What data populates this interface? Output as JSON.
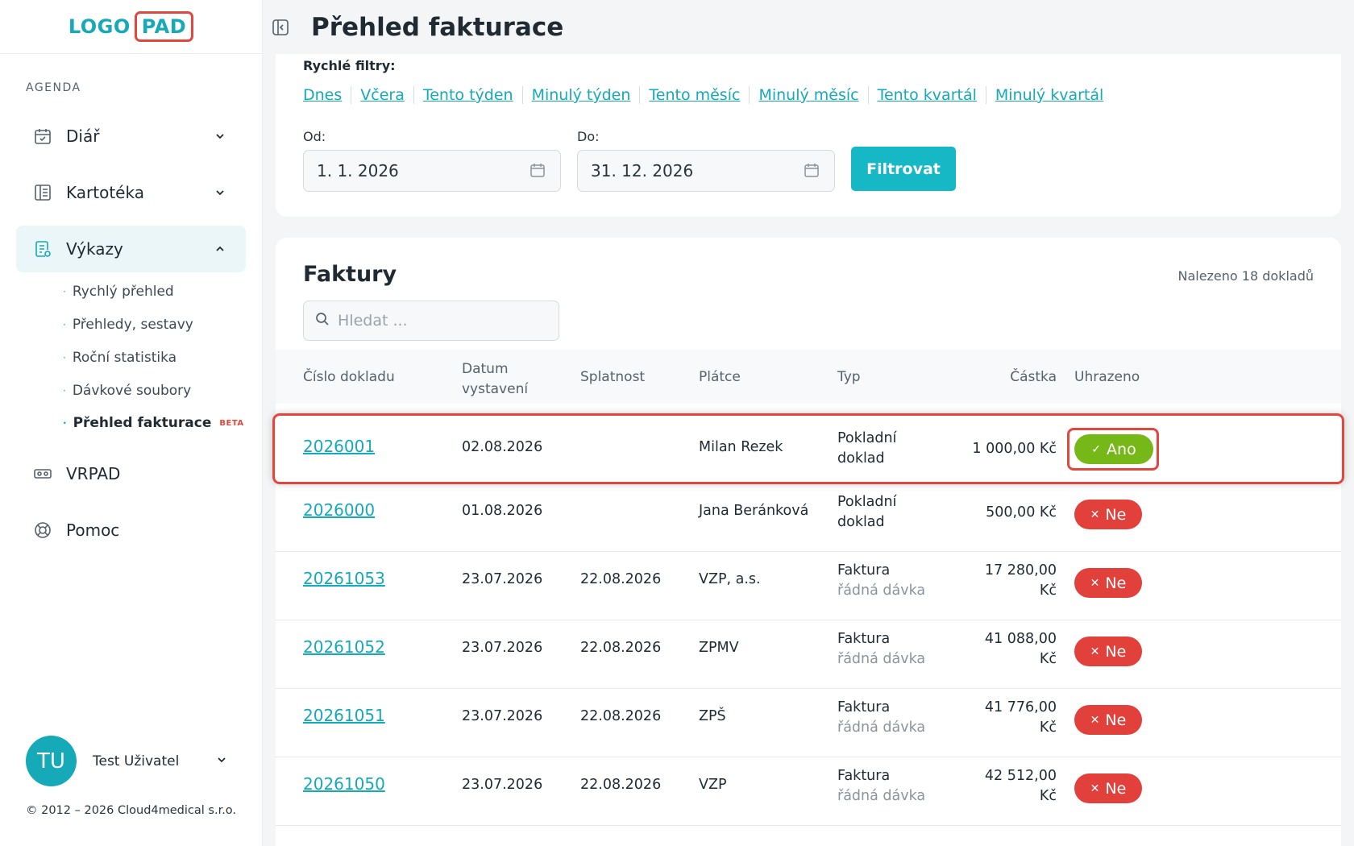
{
  "logo": {
    "part1": "LOGO",
    "part2": "PAD"
  },
  "sidebar": {
    "section_title": "AGENDA",
    "items": [
      {
        "label": "Diář",
        "icon": "calendar-icon"
      },
      {
        "label": "Kartotéka",
        "icon": "file-cabinet-icon"
      },
      {
        "label": "Výkazy",
        "icon": "report-icon"
      },
      {
        "label": "VRPAD",
        "icon": "vr-headset-icon"
      },
      {
        "label": "Pomoc",
        "icon": "lifebuoy-icon"
      }
    ],
    "sub_items": [
      {
        "label": "Rychlý přehled"
      },
      {
        "label": "Přehledy, sestavy"
      },
      {
        "label": "Roční statistika"
      },
      {
        "label": "Dávkové soubory"
      },
      {
        "label": "Přehled fakturace",
        "badge": "BETA"
      }
    ]
  },
  "user": {
    "initials": "TU",
    "name": "Test Uživatel"
  },
  "copyright": "© 2012 – 2026 Cloud4medical s.r.o.",
  "header": {
    "title": "Přehled fakturace"
  },
  "filters": {
    "quick_label": "Rychlé filtry:",
    "quick": [
      "Dnes",
      "Včera",
      "Tento týden",
      "Minulý týden",
      "Tento měsíc",
      "Minulý měsíc",
      "Tento kvartál",
      "Minulý kvartál"
    ],
    "from_label": "Od:",
    "from_value": "1. 1. 2026",
    "to_label": "Do:",
    "to_value": "31. 12. 2026",
    "button": "Filtrovat"
  },
  "invoices": {
    "title": "Faktury",
    "found": "Nalezeno 18 dokladů",
    "search_placeholder": "Hledat ...",
    "columns": {
      "number": "Číslo dokladu",
      "issued_1": "Datum",
      "issued_2": "vystavení",
      "due": "Splatnost",
      "payer": "Plátce",
      "type": "Typ",
      "amount": "Částka",
      "paid": "Uhrazeno"
    },
    "rows": [
      {
        "number": "2026001",
        "issued": "02.08.2026",
        "due": "",
        "payer": "Milan Rezek",
        "type_1": "Pokladní",
        "type_2": "doklad",
        "amount_1": "1 000,00 Kč",
        "amount_2": "",
        "paid": "Ano"
      },
      {
        "number": "2026000",
        "issued": "01.08.2026",
        "due": "",
        "payer": "Jana Beránková",
        "type_1": "Pokladní",
        "type_2": "doklad",
        "amount_1": "500,00 Kč",
        "amount_2": "",
        "paid": "Ne"
      },
      {
        "number": "20261053",
        "issued": "23.07.2026",
        "due": "22.08.2026",
        "payer": "VZP, a.s.",
        "type_1": "Faktura",
        "type_2": "řádná dávka",
        "amount_1": "17 280,00",
        "amount_2": "Kč",
        "paid": "Ne"
      },
      {
        "number": "20261052",
        "issued": "23.07.2026",
        "due": "22.08.2026",
        "payer": "ZPMV",
        "type_1": "Faktura",
        "type_2": "řádná dávka",
        "amount_1": "41 088,00",
        "amount_2": "Kč",
        "paid": "Ne"
      },
      {
        "number": "20261051",
        "issued": "23.07.2026",
        "due": "22.08.2026",
        "payer": "ZPŠ",
        "type_1": "Faktura",
        "type_2": "řádná dávka",
        "amount_1": "41 776,00",
        "amount_2": "Kč",
        "paid": "Ne"
      },
      {
        "number": "20261050",
        "issued": "23.07.2026",
        "due": "22.08.2026",
        "payer": "VZP",
        "type_1": "Faktura",
        "type_2": "řádná dávka",
        "amount_1": "42 512,00",
        "amount_2": "Kč",
        "paid": "Ne"
      }
    ]
  },
  "colors": {
    "accent": "#16a9b8",
    "highlight": "#e2473f",
    "paid_yes": "#76b818",
    "paid_no": "#e2403b"
  }
}
